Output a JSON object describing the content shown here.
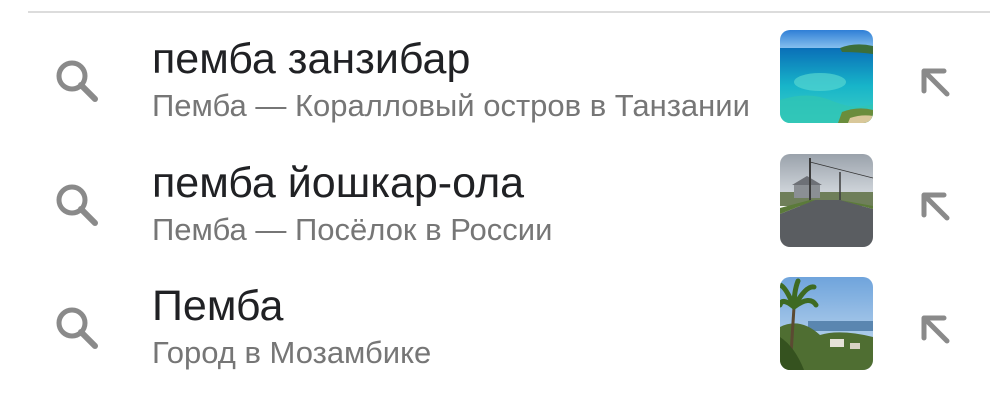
{
  "suggestions": [
    {
      "title": "пемба занзибар",
      "subtitle": "Пемба — Коралловый остров в Танзании",
      "thumbnail": "tropical-coast-photo",
      "search_icon": "search-icon",
      "fill_icon": "arrow-up-left-icon"
    },
    {
      "title": "пемба йошкар-ола",
      "subtitle": "Пемба — Посёлок в России",
      "thumbnail": "village-road-photo",
      "search_icon": "search-icon",
      "fill_icon": "arrow-up-left-icon"
    },
    {
      "title": "Пемба",
      "subtitle": "Город в Мозамбике",
      "thumbnail": "palm-town-photo",
      "search_icon": "search-icon",
      "fill_icon": "arrow-up-left-icon"
    }
  ],
  "colors": {
    "title": "#202124",
    "subtitle": "#767676",
    "icon": "#8a8a8a",
    "divider": "#dcdcdc"
  }
}
